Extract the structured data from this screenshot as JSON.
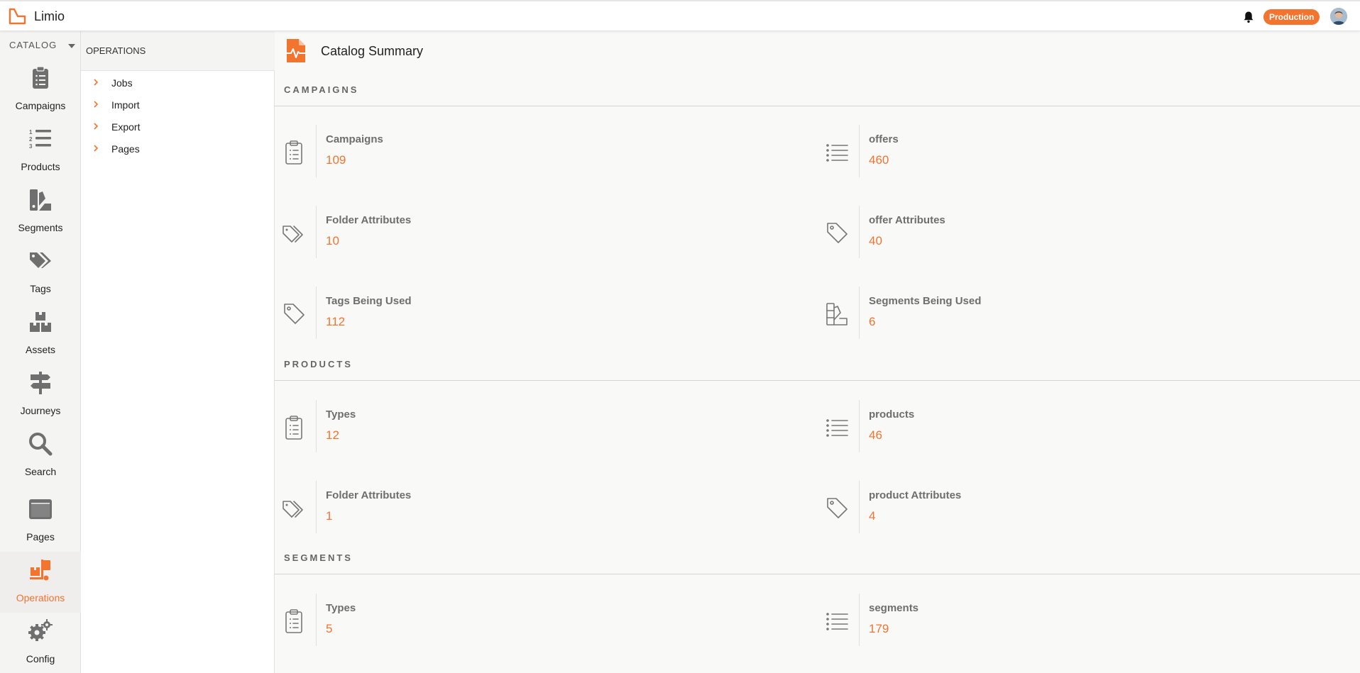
{
  "app": {
    "title": "Limio",
    "environment": "Production"
  },
  "colors": {
    "accent": "#f3742f",
    "icon_gray": "#6f6f6f"
  },
  "rail": {
    "header": "CATALOG",
    "items": [
      {
        "label": "Campaigns",
        "icon": "clipboard-icon"
      },
      {
        "label": "Products",
        "icon": "numbered-list-icon"
      },
      {
        "label": "Segments",
        "icon": "swatch-icon"
      },
      {
        "label": "Tags",
        "icon": "tags-icon"
      },
      {
        "label": "Assets",
        "icon": "boxes-icon"
      },
      {
        "label": "Journeys",
        "icon": "signpost-icon"
      },
      {
        "label": "Search",
        "icon": "search-icon"
      },
      {
        "label": "Pages",
        "icon": "window-icon"
      },
      {
        "label": "Operations",
        "icon": "dolly-icon",
        "active": true
      },
      {
        "label": "Config",
        "icon": "gears-icon"
      }
    ]
  },
  "subnav": {
    "header": "OPERATIONS",
    "items": [
      {
        "label": "Jobs"
      },
      {
        "label": "Import"
      },
      {
        "label": "Export"
      },
      {
        "label": "Pages"
      }
    ]
  },
  "main": {
    "title": "Catalog Summary",
    "sections": [
      {
        "title": "CAMPAIGNS",
        "stats": [
          {
            "label": "Campaigns",
            "value": "109",
            "icon": "clipboard-list-icon"
          },
          {
            "label": "offers",
            "value": "460",
            "icon": "list-icon"
          },
          {
            "label": "Folder Attributes",
            "value": "10",
            "icon": "tags-icon"
          },
          {
            "label": "offer Attributes",
            "value": "40",
            "icon": "tag-icon"
          },
          {
            "label": "Tags Being Used",
            "value": "112",
            "icon": "tag-icon"
          },
          {
            "label": "Segments Being Used",
            "value": "6",
            "icon": "swatch-icon"
          }
        ]
      },
      {
        "title": "PRODUCTS",
        "stats": [
          {
            "label": "Types",
            "value": "12",
            "icon": "clipboard-list-icon"
          },
          {
            "label": "products",
            "value": "46",
            "icon": "list-icon"
          },
          {
            "label": "Folder Attributes",
            "value": "1",
            "icon": "tags-icon"
          },
          {
            "label": "product Attributes",
            "value": "4",
            "icon": "tag-icon"
          }
        ]
      },
      {
        "title": "SEGMENTS",
        "stats": [
          {
            "label": "Types",
            "value": "5",
            "icon": "clipboard-list-icon"
          },
          {
            "label": "segments",
            "value": "179",
            "icon": "list-icon"
          }
        ]
      }
    ]
  }
}
